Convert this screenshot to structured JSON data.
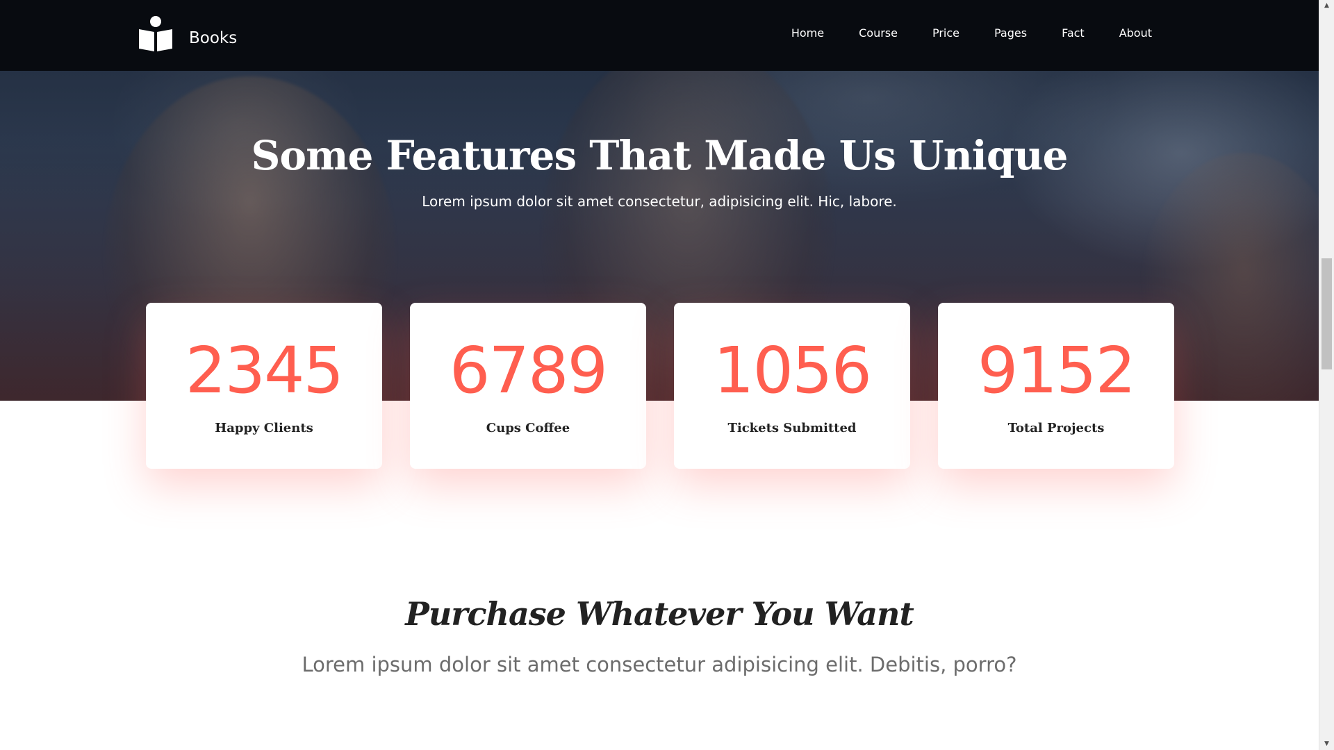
{
  "navbar": {
    "brand_name": "Books",
    "brand_icon": "book-reader-icon",
    "links": [
      "Home",
      "Course",
      "Price",
      "Pages",
      "Fact",
      "About"
    ]
  },
  "hero": {
    "title": "Some Features That Made Us Unique",
    "subtitle": "Lorem ipsum dolor sit amet consectetur, adipisicing elit. Hic, labore."
  },
  "stats": [
    {
      "value": "2345",
      "label": "Happy Clients"
    },
    {
      "value": "6789",
      "label": "Cups Coffee"
    },
    {
      "value": "1056",
      "label": "Tickets Submitted"
    },
    {
      "value": "9152",
      "label": "Total Projects"
    }
  ],
  "purchase": {
    "title": "Purchase Whatever You Want",
    "subtitle": "Lorem ipsum dolor sit amet consectetur adipisicing elit. Debitis, porro?"
  },
  "colors": {
    "accent": "#ff5e4f",
    "navbar_bg": "#080b10",
    "text_dark": "#222222",
    "text_muted": "#6c6c6c"
  }
}
